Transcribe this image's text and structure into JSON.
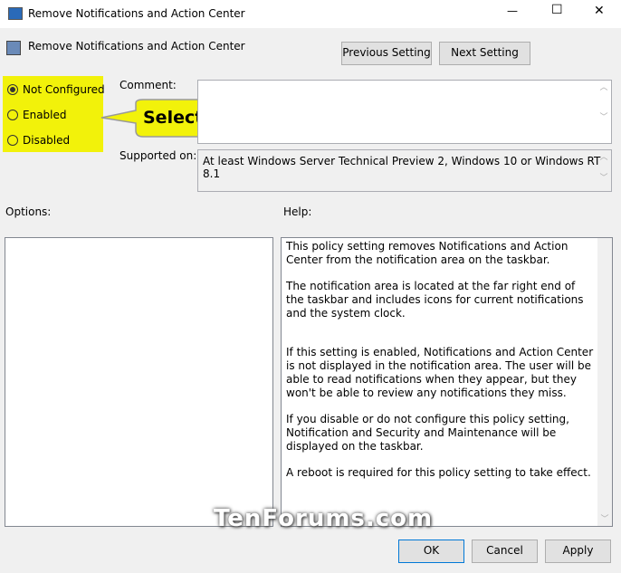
{
  "window": {
    "title": "Remove Notifications and Action Center",
    "minimize": "—",
    "maximize": "☐",
    "close": "✕"
  },
  "header": {
    "title": "Remove Notifications and Action Center",
    "prev_label": "Previous Setting",
    "next_label": "Next Setting"
  },
  "state": {
    "options": [
      "Not Configured",
      "Enabled",
      "Disabled"
    ],
    "selected": "Not Configured"
  },
  "callout": "Select",
  "comment": {
    "label": "Comment:",
    "value": ""
  },
  "supported": {
    "label": "Supported on:",
    "value": "At least Windows Server Technical Preview 2, Windows 10 or Windows RT 8.1"
  },
  "options_label": "Options:",
  "help_label": "Help:",
  "help": [
    "This policy setting removes Notifications and Action Center from the notification area on the taskbar.",
    "The notification area is located at the far right end of the taskbar and includes icons for current notifications and the system clock.",
    "If this setting is enabled, Notifications and Action Center is not displayed in the notification area. The user will be able to read notifications when they appear, but they won't be able to review any notifications they miss.",
    "If you disable or do not configure this policy setting, Notification and Security and Maintenance will be displayed on the taskbar.",
    "A reboot is required for this policy setting to take effect."
  ],
  "watermark": "TenForums.com",
  "footer": {
    "ok": "OK",
    "cancel": "Cancel",
    "apply": "Apply"
  },
  "colors": {
    "highlight": "#f2f20a",
    "focus_border": "#0078d7"
  }
}
